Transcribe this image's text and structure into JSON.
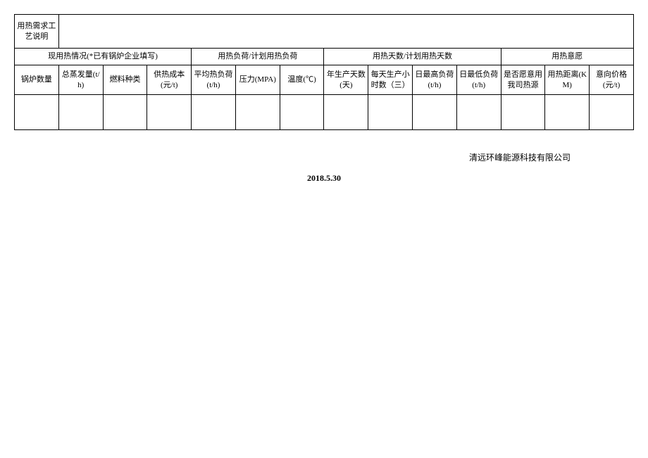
{
  "noteLabel": "用热需求工艺说明",
  "noteValue": "",
  "groups": {
    "g1": "现用热情况(*已有锅炉企业填写)",
    "g2": "用热负荷/计划用热负荷",
    "g3": "用热天数/计划用热天数",
    "g4": "用热意愿"
  },
  "subs": {
    "c1": "锅炉数量",
    "c2": "总蒸发量(t/h)",
    "c3": "燃料种类",
    "c4": "供热成本(元/t)",
    "c5": "平均热负荷(t/h)",
    "c6": "压力(MPA)",
    "c7": "温度(℃)",
    "c8": "年生产天数(天)",
    "c9": "每天生产小时数（三）",
    "c10": "日最高负荷(t/h)",
    "c11": "日最低负荷(t/h)",
    "c12": "是否愿意用我司热源",
    "c13": "用热距离(KM)",
    "c14": "意向价格(元/t)"
  },
  "dataRow": {
    "c1": "",
    "c2": "",
    "c3": "",
    "c4": "",
    "c5": "",
    "c6": "",
    "c7": "",
    "c8": "",
    "c9": "",
    "c10": "",
    "c11": "",
    "c12": "",
    "c13": "",
    "c14": ""
  },
  "company": "清远环峰能源科技有限公司",
  "date": "2018.5.30"
}
